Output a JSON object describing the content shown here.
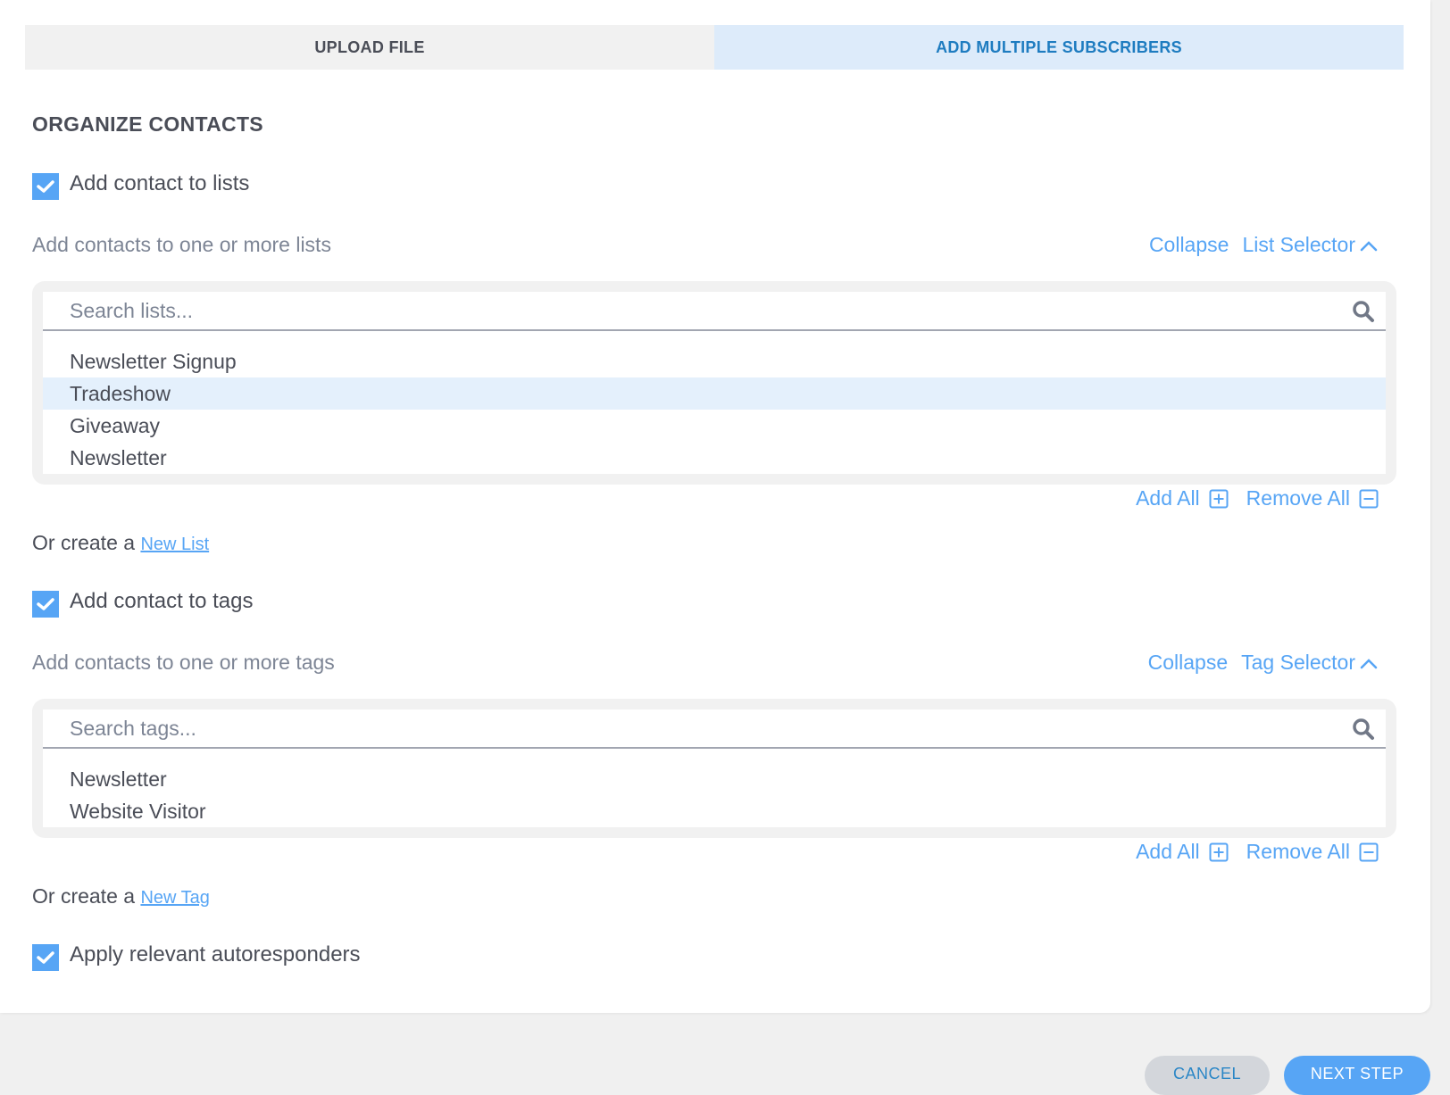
{
  "tabs": [
    {
      "label": "UPLOAD FILE",
      "active": false
    },
    {
      "label": "ADD MULTIPLE SUBSCRIBERS",
      "active": true
    }
  ],
  "section_title": "ORGANIZE CONTACTS",
  "lists": {
    "checkbox_label": "Add contact to lists",
    "checked": true,
    "hint": "Add contacts to one or more lists",
    "collapse_label": "Collapse",
    "selector_label": "List Selector",
    "search_placeholder": "Search lists...",
    "search_value": "",
    "items": [
      {
        "label": "Newsletter Signup",
        "highlighted": false
      },
      {
        "label": "Tradeshow",
        "highlighted": true
      },
      {
        "label": "Giveaway",
        "highlighted": false
      },
      {
        "label": "Newsletter",
        "highlighted": false
      }
    ],
    "add_all_label": "Add All",
    "remove_all_label": "Remove All",
    "create_prefix": "Or create a",
    "create_link": "New List"
  },
  "tags": {
    "checkbox_label": "Add contact to tags",
    "checked": true,
    "hint": "Add contacts to one or more tags",
    "collapse_label": "Collapse",
    "selector_label": "Tag Selector",
    "search_placeholder": "Search tags...",
    "search_value": "",
    "items": [
      {
        "label": "Newsletter",
        "highlighted": false
      },
      {
        "label": "Website Visitor",
        "highlighted": false
      }
    ],
    "add_all_label": "Add All",
    "remove_all_label": "Remove All",
    "create_prefix": "Or create a",
    "create_link": "New Tag"
  },
  "autoresponders": {
    "checkbox_label": "Apply relevant autoresponders",
    "checked": true
  },
  "footer": {
    "cancel_label": "CANCEL",
    "next_label": "NEXT STEP"
  },
  "colors": {
    "accent": "#57a5f5",
    "active_tab_bg": "#ddebfa",
    "active_tab_text": "#1e7cc0",
    "highlight_row": "#e4f0fc"
  }
}
